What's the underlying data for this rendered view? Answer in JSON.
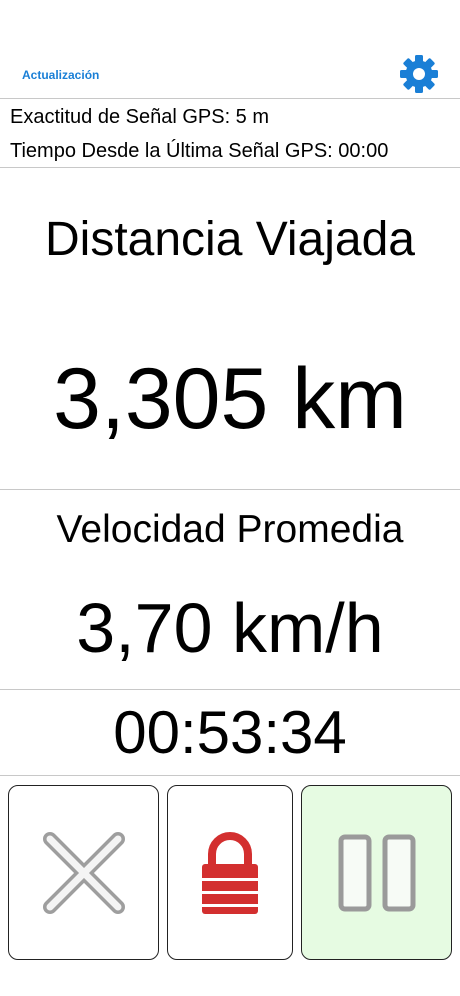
{
  "header": {
    "update_label": "Actualización",
    "settings_icon": "gear-icon",
    "accent_color": "#1a7fd6"
  },
  "gps": {
    "accuracy_text": "Exactitud de Señal GPS: 5 m",
    "last_signal_text": "Tiempo Desde la Última Señal GPS: 00:00"
  },
  "distance": {
    "label": "Distancia Viajada",
    "value": "3,305 km"
  },
  "speed": {
    "label": "Velocidad Promedia",
    "value": "3,70 km/h"
  },
  "timer": {
    "value": "00:53:34"
  },
  "controls": {
    "cancel_icon": "close-icon",
    "lock_icon": "lock-icon",
    "pause_icon": "pause-icon",
    "lock_color": "#d32f2f",
    "pause_bg": "#e6fbe2"
  }
}
